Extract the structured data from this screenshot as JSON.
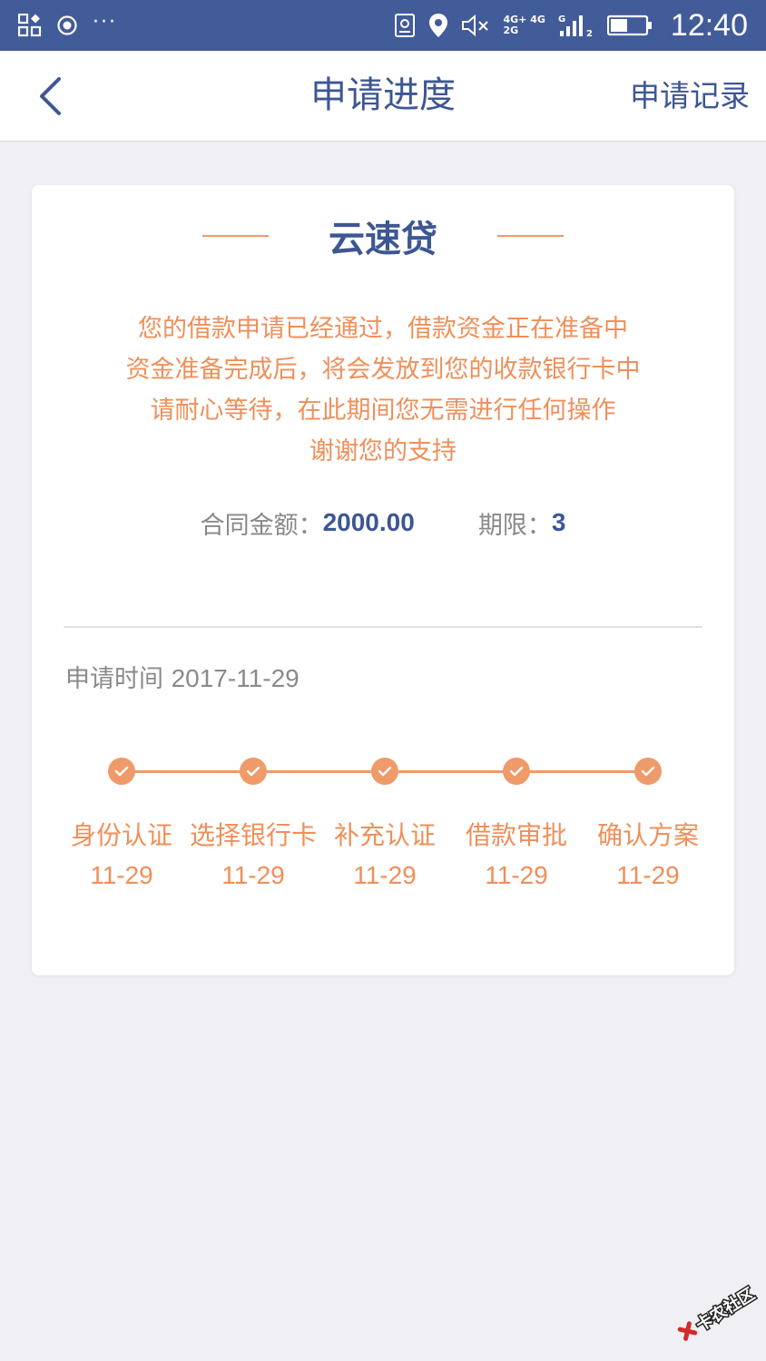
{
  "status_bar": {
    "time": "12:40",
    "dots": "···",
    "net_top": "4G+ 4G",
    "net_bottom": "2G",
    "signal_label": "G",
    "sim2": "2"
  },
  "nav": {
    "title": "申请进度",
    "right_link": "申请记录"
  },
  "card": {
    "title": "云速贷",
    "message_lines": [
      "您的借款申请已经通过，借款资金正在准备中",
      "资金准备完成后，将会发放到您的收款银行卡中",
      "请耐心等待，在此期间您无需进行任何操作",
      "谢谢您的支持"
    ],
    "amount_label": "合同金额：",
    "amount_value": "2000.00",
    "term_label": "期限：",
    "term_value": "3",
    "apply_time_label": "申请时间",
    "apply_time_value": "2017-11-29"
  },
  "steps": [
    {
      "label": "身份认证",
      "date": "11-29",
      "completed": true
    },
    {
      "label": "选择银行卡",
      "date": "11-29",
      "completed": true
    },
    {
      "label": "补充认证",
      "date": "11-29",
      "completed": true
    },
    {
      "label": "借款审批",
      "date": "11-29",
      "completed": true
    },
    {
      "label": "确认方案",
      "date": "11-29",
      "completed": true
    }
  ],
  "colors": {
    "status_bar_bg": "#425b99",
    "primary": "#3d5694",
    "accent_orange": "#ef9a69",
    "page_bg": "#efeff4"
  },
  "icons": {
    "back": "chevron-left-icon",
    "step_check": "check-icon"
  },
  "watermark": {
    "text": "卡农社区"
  }
}
